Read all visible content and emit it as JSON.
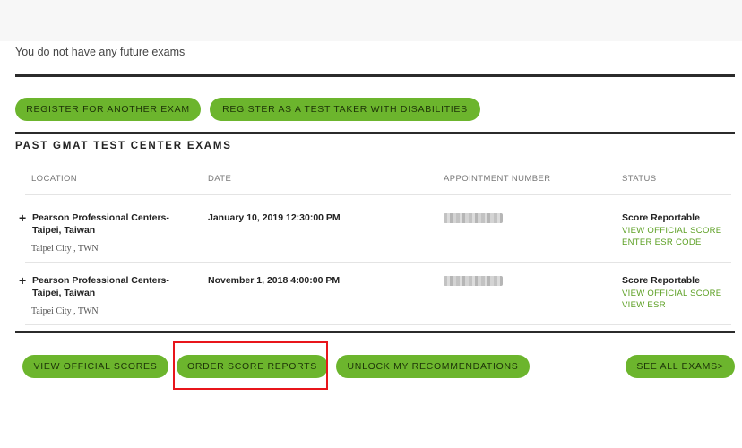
{
  "future_exams_message": "You do not have any future exams",
  "register_buttons": {
    "register_another": "REGISTER FOR ANOTHER EXAM",
    "register_disabilities": "REGISTER AS A TEST TAKER WITH DISABILITIES"
  },
  "past_section": {
    "title": "PAST GMAT TEST CENTER EXAMS",
    "columns": [
      "LOCATION",
      "DATE",
      "APPOINTMENT NUMBER",
      "STATUS"
    ],
    "rows": [
      {
        "expand_icon": "+",
        "location_line1": "Pearson Professional Centers-",
        "location_line2": "Taipei, Taiwan",
        "city": "Taipei City , TWN",
        "date": "January 10, 2019 12:30:00 PM",
        "status": "Score Reportable",
        "link1": "VIEW OFFICIAL SCORE",
        "link2": "ENTER ESR CODE"
      },
      {
        "expand_icon": "+",
        "location_line1": "Pearson Professional Centers-",
        "location_line2": "Taipei, Taiwan",
        "city": "Taipei City , TWN",
        "date": "November 1, 2018 4:00:00 PM",
        "status": "Score Reportable",
        "link1": "VIEW OFFICIAL SCORE",
        "link2": "VIEW ESR"
      }
    ]
  },
  "bottom_buttons": {
    "view_scores": "VIEW OFFICIAL SCORES",
    "order_reports": "ORDER SCORE REPORTS",
    "unlock": "UNLOCK MY RECOMMENDATIONS",
    "see_all": "SEE ALL EXAMS>"
  },
  "colors": {
    "button_green": "#6cb52d",
    "link_green": "#5b9f22",
    "highlight_red": "#e8151b"
  }
}
